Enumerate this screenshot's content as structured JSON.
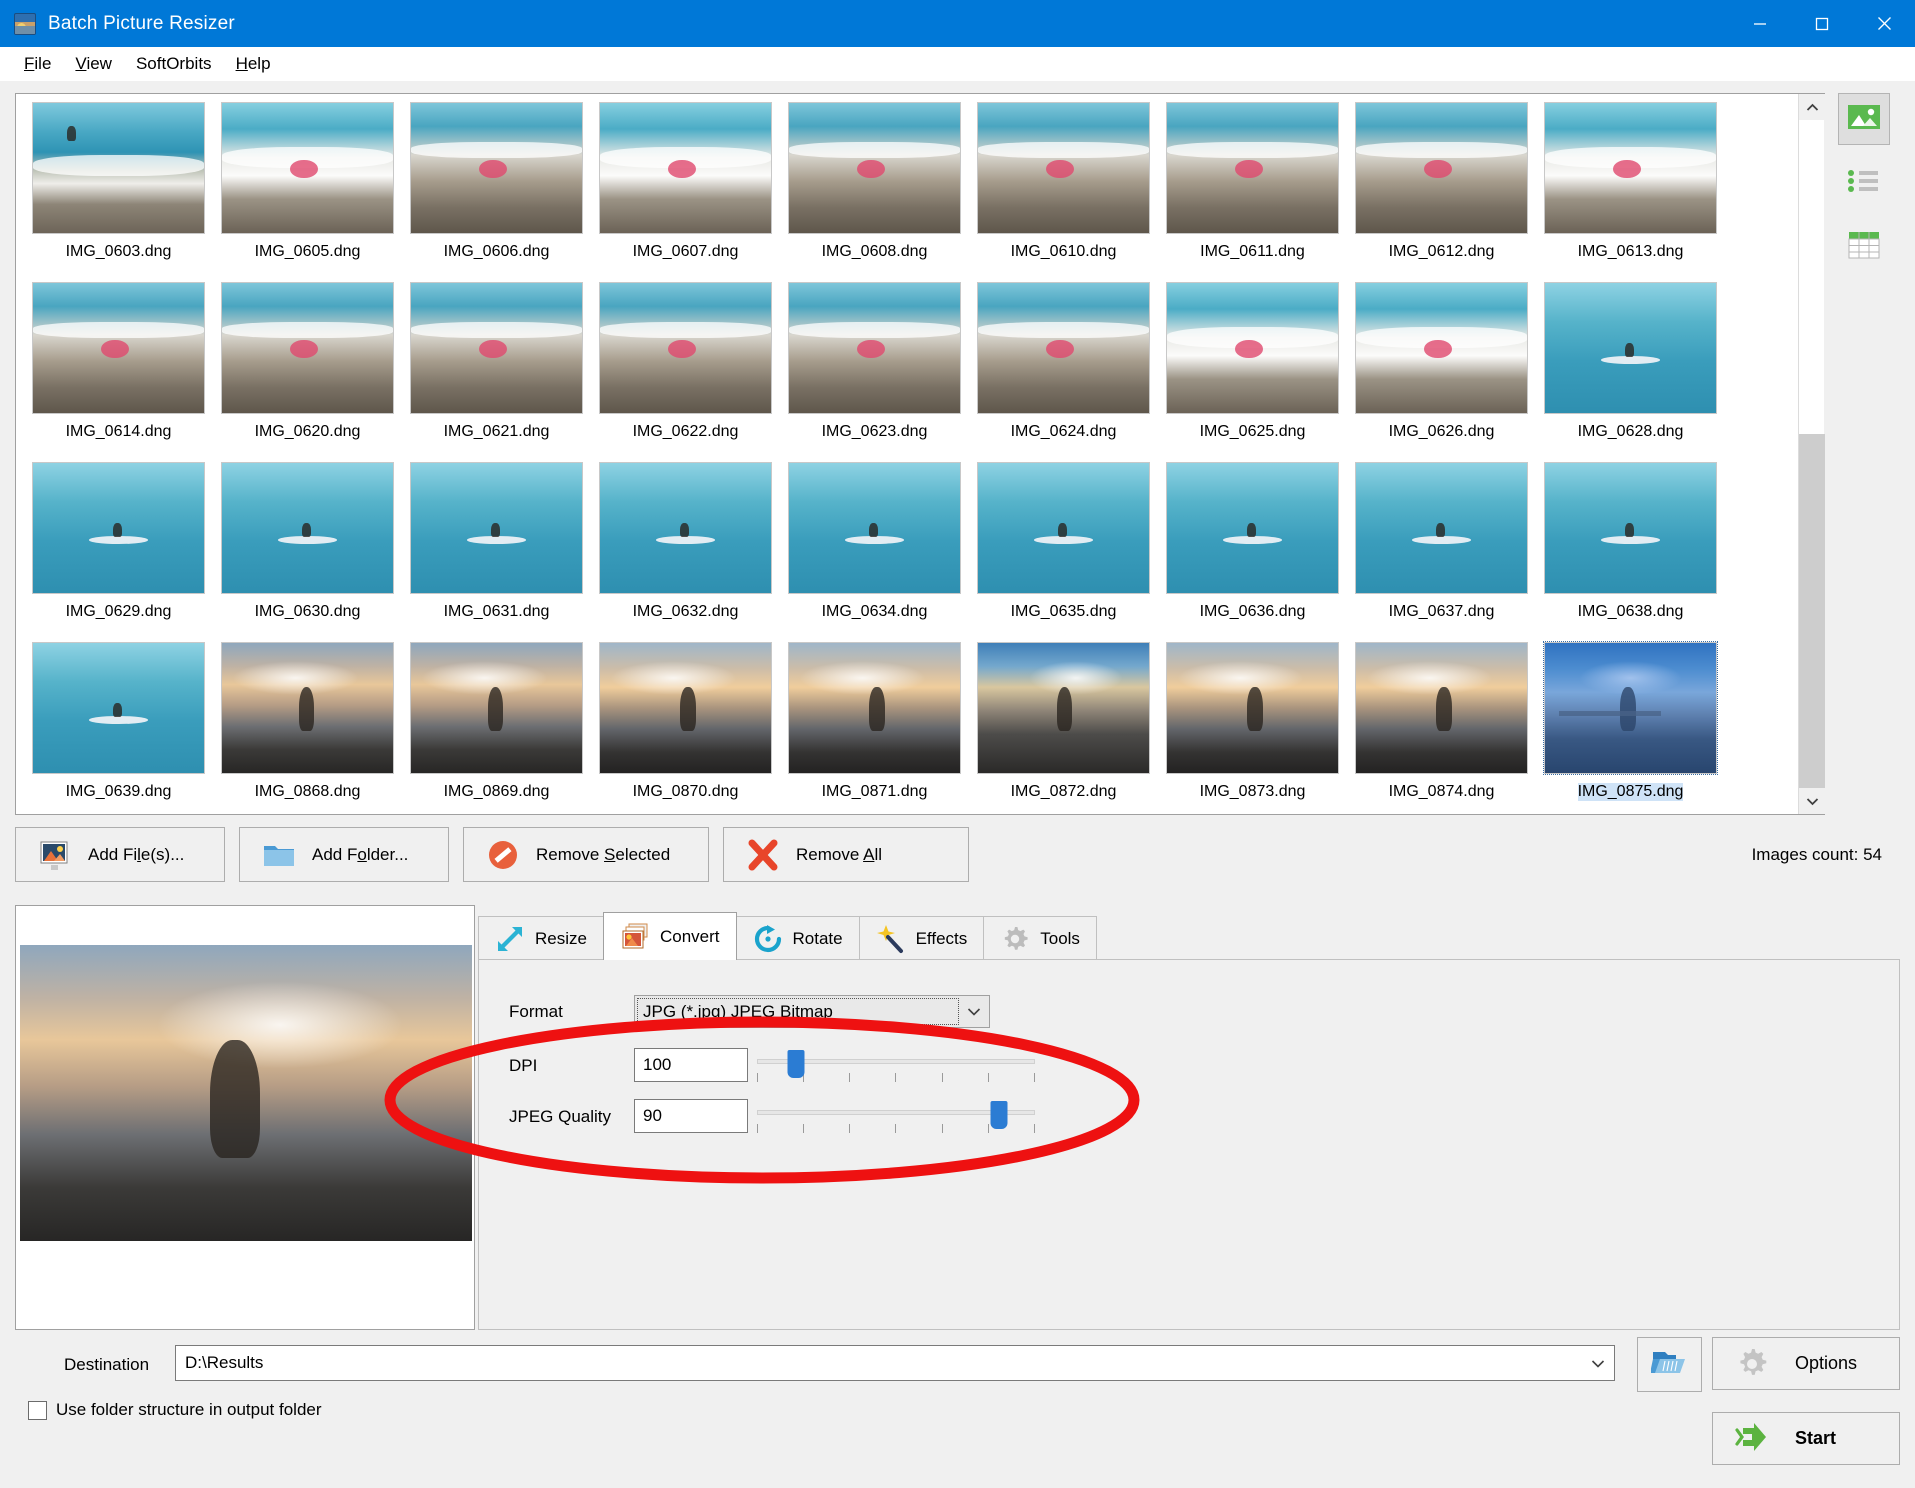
{
  "window": {
    "title": "Batch Picture Resizer",
    "icon": "app-icon",
    "controls": {
      "minimize": "—",
      "maximize": "□",
      "close": "✕"
    }
  },
  "menubar": {
    "items": [
      {
        "label": "File",
        "accel": "F"
      },
      {
        "label": "View",
        "accel": "V"
      },
      {
        "label": "SoftOrbits",
        "accel": ""
      },
      {
        "label": "Help",
        "accel": "H"
      }
    ]
  },
  "thumbnails": {
    "items": [
      {
        "label": "IMG_0603.dng",
        "scene": "sea-top",
        "selected": false
      },
      {
        "label": "IMG_0605.dng",
        "scene": "sea-wave",
        "selected": false
      },
      {
        "label": "IMG_0606.dng",
        "scene": "sea-stone",
        "selected": false
      },
      {
        "label": "IMG_0607.dng",
        "scene": "sea-wave",
        "selected": false
      },
      {
        "label": "IMG_0608.dng",
        "scene": "sea-stone",
        "selected": false
      },
      {
        "label": "IMG_0610.dng",
        "scene": "sea-stone",
        "selected": false
      },
      {
        "label": "IMG_0611.dng",
        "scene": "sea-stone",
        "selected": false
      },
      {
        "label": "IMG_0612.dng",
        "scene": "sea-stone",
        "selected": false
      },
      {
        "label": "IMG_0613.dng",
        "scene": "sea-wave",
        "selected": false
      },
      {
        "label": "IMG_0614.dng",
        "scene": "sea-stone",
        "selected": false
      },
      {
        "label": "IMG_0620.dng",
        "scene": "sea-stone",
        "selected": false
      },
      {
        "label": "IMG_0621.dng",
        "scene": "sea-stone",
        "selected": false
      },
      {
        "label": "IMG_0622.dng",
        "scene": "sea-stone",
        "selected": false
      },
      {
        "label": "IMG_0623.dng",
        "scene": "sea-stone",
        "selected": false
      },
      {
        "label": "IMG_0624.dng",
        "scene": "sea-stone",
        "selected": false
      },
      {
        "label": "IMG_0625.dng",
        "scene": "sea-wave",
        "selected": false
      },
      {
        "label": "IMG_0626.dng",
        "scene": "sea-wave",
        "selected": false
      },
      {
        "label": "IMG_0628.dng",
        "scene": "sea-calm",
        "selected": false
      },
      {
        "label": "IMG_0629.dng",
        "scene": "sea-calm",
        "selected": false
      },
      {
        "label": "IMG_0630.dng",
        "scene": "sea-calm",
        "selected": false
      },
      {
        "label": "IMG_0631.dng",
        "scene": "sea-calm",
        "selected": false
      },
      {
        "label": "IMG_0632.dng",
        "scene": "sea-calm",
        "selected": false
      },
      {
        "label": "IMG_0634.dng",
        "scene": "sea-calm",
        "selected": false
      },
      {
        "label": "IMG_0635.dng",
        "scene": "sea-calm",
        "selected": false
      },
      {
        "label": "IMG_0636.dng",
        "scene": "sea-calm",
        "selected": false
      },
      {
        "label": "IMG_0637.dng",
        "scene": "sea-calm",
        "selected": false
      },
      {
        "label": "IMG_0638.dng",
        "scene": "sea-calm",
        "selected": false
      },
      {
        "label": "IMG_0639.dng",
        "scene": "sea-calm",
        "selected": false
      },
      {
        "label": "IMG_0868.dng",
        "scene": "sunset-a",
        "selected": false
      },
      {
        "label": "IMG_0869.dng",
        "scene": "sunset-a",
        "selected": false
      },
      {
        "label": "IMG_0870.dng",
        "scene": "sunset-b",
        "selected": false
      },
      {
        "label": "IMG_0871.dng",
        "scene": "sunset-b",
        "selected": false
      },
      {
        "label": "IMG_0872.dng",
        "scene": "sunset-c",
        "selected": false
      },
      {
        "label": "IMG_0873.dng",
        "scene": "sunset-b",
        "selected": false
      },
      {
        "label": "IMG_0874.dng",
        "scene": "sunset-b",
        "selected": false
      },
      {
        "label": "IMG_0875.dng",
        "scene": "sunset-d",
        "selected": true
      }
    ]
  },
  "view_modes": [
    {
      "icon": "thumbnails-view-icon",
      "active": true
    },
    {
      "icon": "list-view-icon",
      "active": false
    },
    {
      "icon": "details-view-icon",
      "active": false
    }
  ],
  "actions": {
    "add_files": {
      "label_pre": "Add Fi",
      "accel": "l",
      "label_post": "e(s)...",
      "icon": "add-image-icon"
    },
    "add_folder": {
      "label_pre": "Add F",
      "accel": "o",
      "label_post": "lder...",
      "icon": "folder-icon"
    },
    "remove_selected": {
      "label_pre": "Remove ",
      "accel": "S",
      "label_post": "elected",
      "icon": "no-entry-icon"
    },
    "remove_all": {
      "label_pre": "Remove ",
      "accel": "A",
      "label_post": "ll",
      "icon": "red-x-icon"
    },
    "images_count": "Images count: 54"
  },
  "tabs": [
    {
      "label": "Resize",
      "icon": "resize-arrow-icon",
      "active": false
    },
    {
      "label": "Convert",
      "icon": "convert-images-icon",
      "active": true
    },
    {
      "label": "Rotate",
      "icon": "rotate-icon",
      "active": false
    },
    {
      "label": "Effects",
      "icon": "magic-wand-icon",
      "active": false
    },
    {
      "label": "Tools",
      "icon": "gear-icon",
      "active": false
    }
  ],
  "convert_panel": {
    "format": {
      "label": "Format",
      "value": "JPG (*.jpg) JPEG Bitmap"
    },
    "dpi": {
      "label": "DPI",
      "value": "100",
      "slider_percent": 14,
      "ticks": 7
    },
    "jpeg_quality": {
      "label": "JPEG Quality",
      "value": "90",
      "slider_percent": 87,
      "ticks": 7
    }
  },
  "destination": {
    "label": "Destination",
    "value": "D:\\Results",
    "browse_icon": "open-folder-icon",
    "use_folder_structure": {
      "label": "Use folder structure in output folder",
      "checked": false
    }
  },
  "footer_buttons": {
    "options": {
      "label": "Options",
      "icon": "gear-icon"
    },
    "start": {
      "label": "Start",
      "icon": "green-arrow-icon"
    }
  },
  "annotation": {
    "shape": "ellipse",
    "color": "#ee1111",
    "target": "dpi-and-jpeg-quality"
  }
}
